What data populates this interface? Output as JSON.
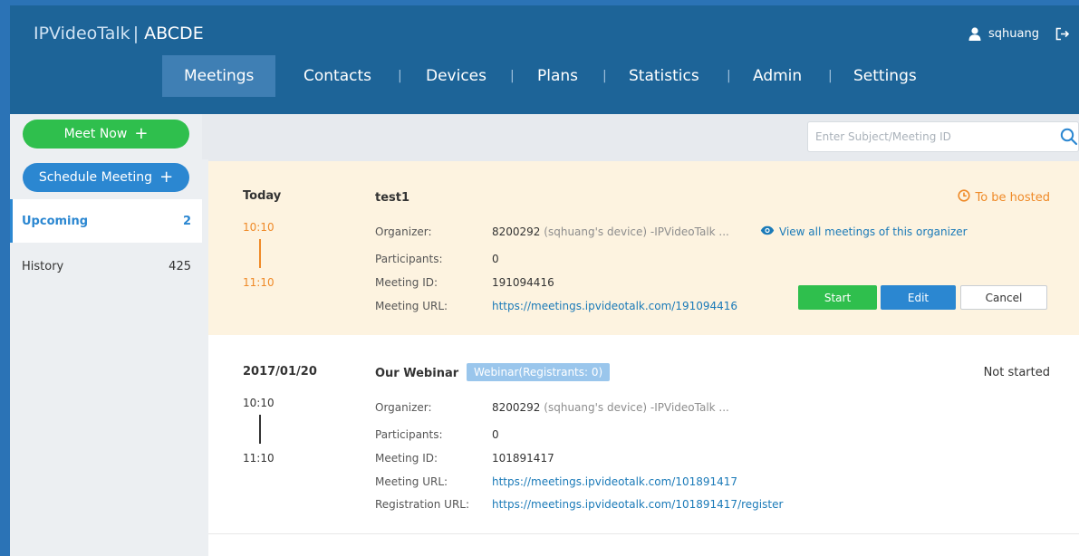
{
  "header": {
    "app_name": "IPVideoTalk",
    "separator": "|",
    "org_name": "ABCDE",
    "username": "sqhuang",
    "nav": [
      {
        "label": "Meetings",
        "active": true
      },
      {
        "label": "Contacts"
      },
      {
        "label": "Devices"
      },
      {
        "label": "Plans"
      },
      {
        "label": "Statistics"
      },
      {
        "label": "Admin"
      },
      {
        "label": "Settings"
      }
    ],
    "nav_separator": "|"
  },
  "sidebar": {
    "meet_now": "Meet Now",
    "schedule_meeting": "Schedule Meeting",
    "plus": "+",
    "items": [
      {
        "label": "Upcoming",
        "count": "2"
      },
      {
        "label": "History",
        "count": "425"
      }
    ]
  },
  "search": {
    "placeholder": "Enter Subject/Meeting ID"
  },
  "labels": {
    "organizer": "Organizer:",
    "participants": "Participants:",
    "meeting_id": "Meeting ID:",
    "meeting_url": "Meeting URL:",
    "registration_url": "Registration URL:"
  },
  "meetings": [
    {
      "date": "Today",
      "start": "10:10",
      "end": "11:10",
      "title": "test1",
      "status": "To be hosted",
      "organizer_id": "8200292",
      "organizer_detail": "(sqhuang's device) -IPVideoTalk ...",
      "view_all": "View all meetings of this organizer",
      "participants": "0",
      "meeting_id": "191094416",
      "meeting_url": "https://meetings.ipvideotalk.com/191094416",
      "actions": {
        "start": "Start",
        "edit": "Edit",
        "cancel": "Cancel"
      }
    },
    {
      "date": "2017/01/20",
      "start": "10:10",
      "end": "11:10",
      "title": "Our Webinar",
      "badge": "Webinar(Registrants: 0)",
      "status": "Not started",
      "organizer_id": "8200292",
      "organizer_detail": "(sqhuang's device) -IPVideoTalk ...",
      "participants": "0",
      "meeting_id": "101891417",
      "meeting_url": "https://meetings.ipvideotalk.com/101891417",
      "registration_url": "https://meetings.ipvideotalk.com/101891417/register"
    }
  ],
  "colors": {
    "header_bg": "#1d6498",
    "accent_blue": "#2b87d1",
    "green": "#2fbf4d",
    "orange": "#ef8a28",
    "highlight_bg": "#fdf3e0"
  }
}
